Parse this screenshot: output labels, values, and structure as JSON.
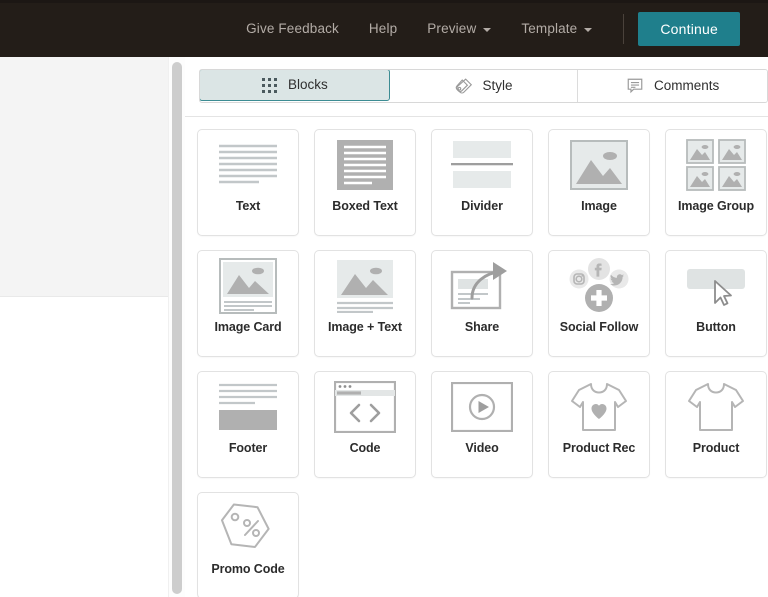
{
  "header": {
    "nav": [
      {
        "label": "Give Feedback",
        "icon": null
      },
      {
        "label": "Help",
        "icon": null
      },
      {
        "label": "Preview",
        "icon": "chevron-down-icon"
      },
      {
        "label": "Template",
        "icon": "chevron-down-icon"
      }
    ],
    "continue_label": "Continue",
    "background_color": "#231d18",
    "accent_color": "#1f7f8c"
  },
  "tabs": [
    {
      "label": "Blocks",
      "icon": "grid-icon",
      "active": true
    },
    {
      "label": "Style",
      "icon": "paint-tag-icon",
      "active": false
    },
    {
      "label": "Comments",
      "icon": "speech-bubble-icon",
      "active": false
    }
  ],
  "blocks": [
    {
      "label": "Text",
      "icon": "text-lines-icon"
    },
    {
      "label": "Boxed Text",
      "icon": "boxed-text-icon"
    },
    {
      "label": "Divider",
      "icon": "divider-icon"
    },
    {
      "label": "Image",
      "icon": "image-icon"
    },
    {
      "label": "Image Group",
      "icon": "image-group-icon"
    },
    {
      "label": "Image Card",
      "icon": "image-card-icon"
    },
    {
      "label": "Image + Text",
      "icon": "image-text-icon"
    },
    {
      "label": "Share",
      "icon": "share-arrow-icon"
    },
    {
      "label": "Social Follow",
      "icon": "social-follow-icon"
    },
    {
      "label": "Button",
      "icon": "button-cursor-icon"
    },
    {
      "label": "Footer",
      "icon": "footer-icon"
    },
    {
      "label": "Code",
      "icon": "code-window-icon"
    },
    {
      "label": "Video",
      "icon": "video-play-icon"
    },
    {
      "label": "Product Rec",
      "icon": "tshirt-heart-icon"
    },
    {
      "label": "Product",
      "icon": "tshirt-icon"
    },
    {
      "label": "Promo Code",
      "icon": "price-tag-percent-icon"
    }
  ],
  "colors": {
    "icon_grey": "#b3b3b3",
    "icon_light": "#e4e8e8",
    "card_border": "#e2e2e2",
    "tab_active_bg": "#dbe5e5",
    "tab_active_border": "#3c8c93"
  }
}
